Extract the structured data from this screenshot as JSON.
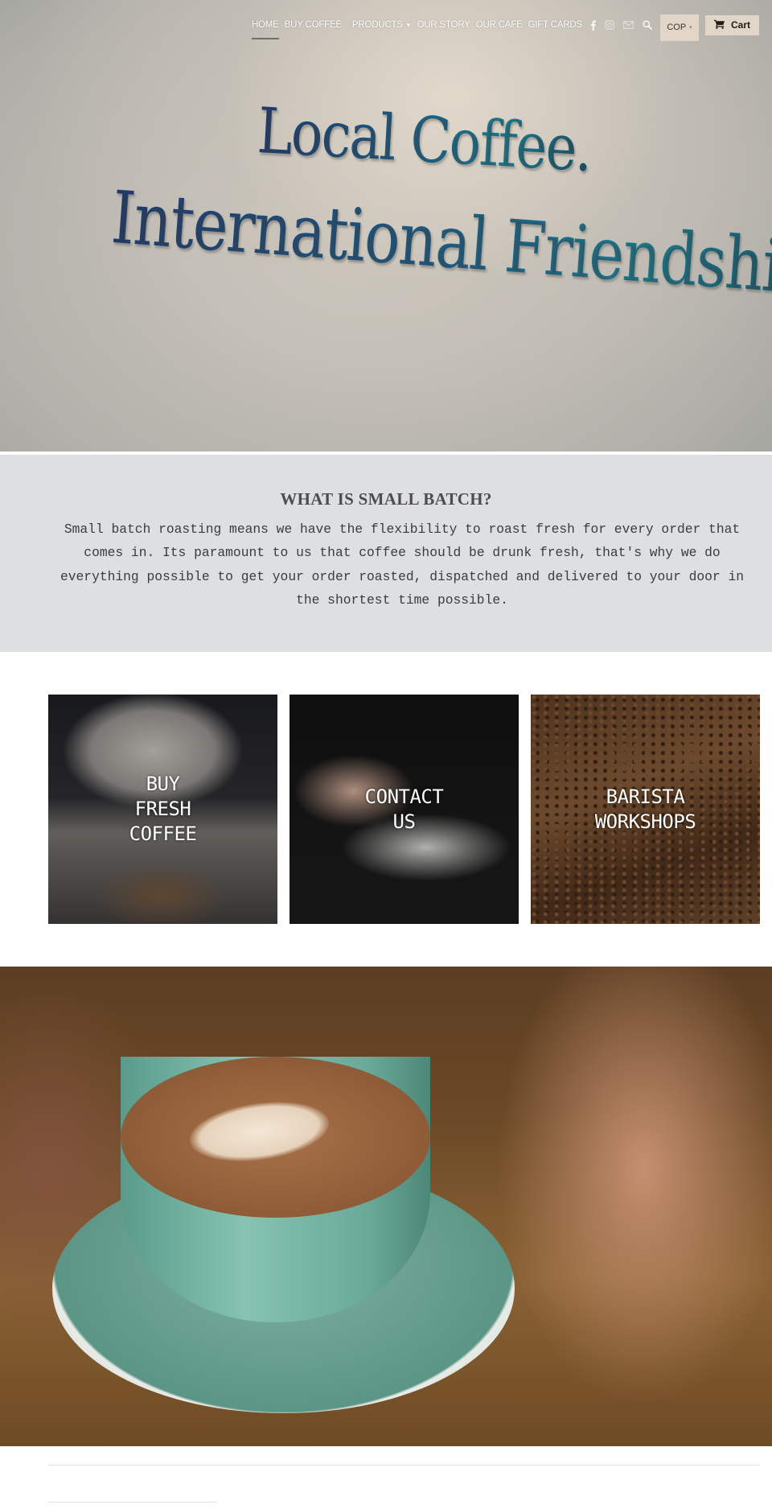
{
  "nav": {
    "links": [
      {
        "label": "Home",
        "active": true
      },
      {
        "label": "Buy Coffee",
        "active": false
      },
      {
        "label": "Products",
        "active": false,
        "has_dropdown": true
      },
      {
        "label": "Our Story",
        "active": false
      },
      {
        "label": "Our Cafe",
        "active": false
      },
      {
        "label": "Gift Cards",
        "active": false
      }
    ],
    "dropdown_caret": "▼",
    "social_icons": [
      "facebook-icon",
      "instagram-icon",
      "email-icon"
    ],
    "search_icon": "search-icon",
    "currency": {
      "selected": "COP",
      "caret": "▾"
    },
    "cart": {
      "label": "Cart",
      "icon": "cart-icon"
    }
  },
  "hero": {
    "image_text_line1": "Local Coffee.",
    "image_text_line2": "International Friendship."
  },
  "small_batch": {
    "title": "WHAT IS SMALL BATCH?",
    "body": "Small batch roasting means we have the flexibility to roast fresh for every order that comes in. Its paramount to us that coffee should be drunk fresh, that's why we do everything possible to get your order roasted, dispatched and delivered to your door in the shortest time possible."
  },
  "tiles": [
    {
      "label": "BUY FRESH COFFEE",
      "image": "coffee-roaster-photo"
    },
    {
      "label": "CONTACT US",
      "image": "laptop-typing-photo"
    },
    {
      "label": "BARISTA WORKSHOPS",
      "image": "coffee-beans-photo"
    }
  ],
  "feature_image": {
    "subject": "latte-art-cup-photo"
  },
  "colors": {
    "band_background": "#dedfe2",
    "button_background": "#e2d6c8",
    "nav_text": "#ffffff"
  }
}
